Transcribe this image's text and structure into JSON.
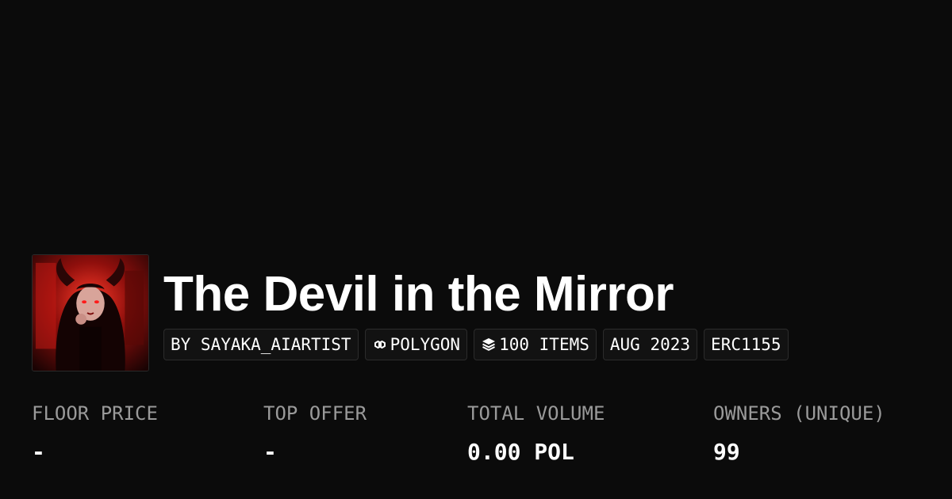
{
  "collection": {
    "title": "The Devil in the Mirror",
    "tags": {
      "creator": "BY SAYAKA_AIARTIST",
      "chain": "POLYGON",
      "items": "100 ITEMS",
      "date": "AUG 2023",
      "standard": "ERC1155"
    },
    "icons": {
      "chain": "polygon-icon",
      "items": "layers-icon"
    }
  },
  "stats": {
    "floor_price": {
      "label": "FLOOR PRICE",
      "value": "-"
    },
    "top_offer": {
      "label": "TOP OFFER",
      "value": "-"
    },
    "total_volume": {
      "label": "TOTAL VOLUME",
      "value": "0.00 POL"
    },
    "owners": {
      "label": "OWNERS (UNIQUE)",
      "value": "99"
    }
  },
  "colors": {
    "background": "#0b0b0b",
    "tag_background": "#121212",
    "tag_border": "#2c2c2c",
    "label": "#9a9a9a",
    "text": "#ffffff"
  }
}
